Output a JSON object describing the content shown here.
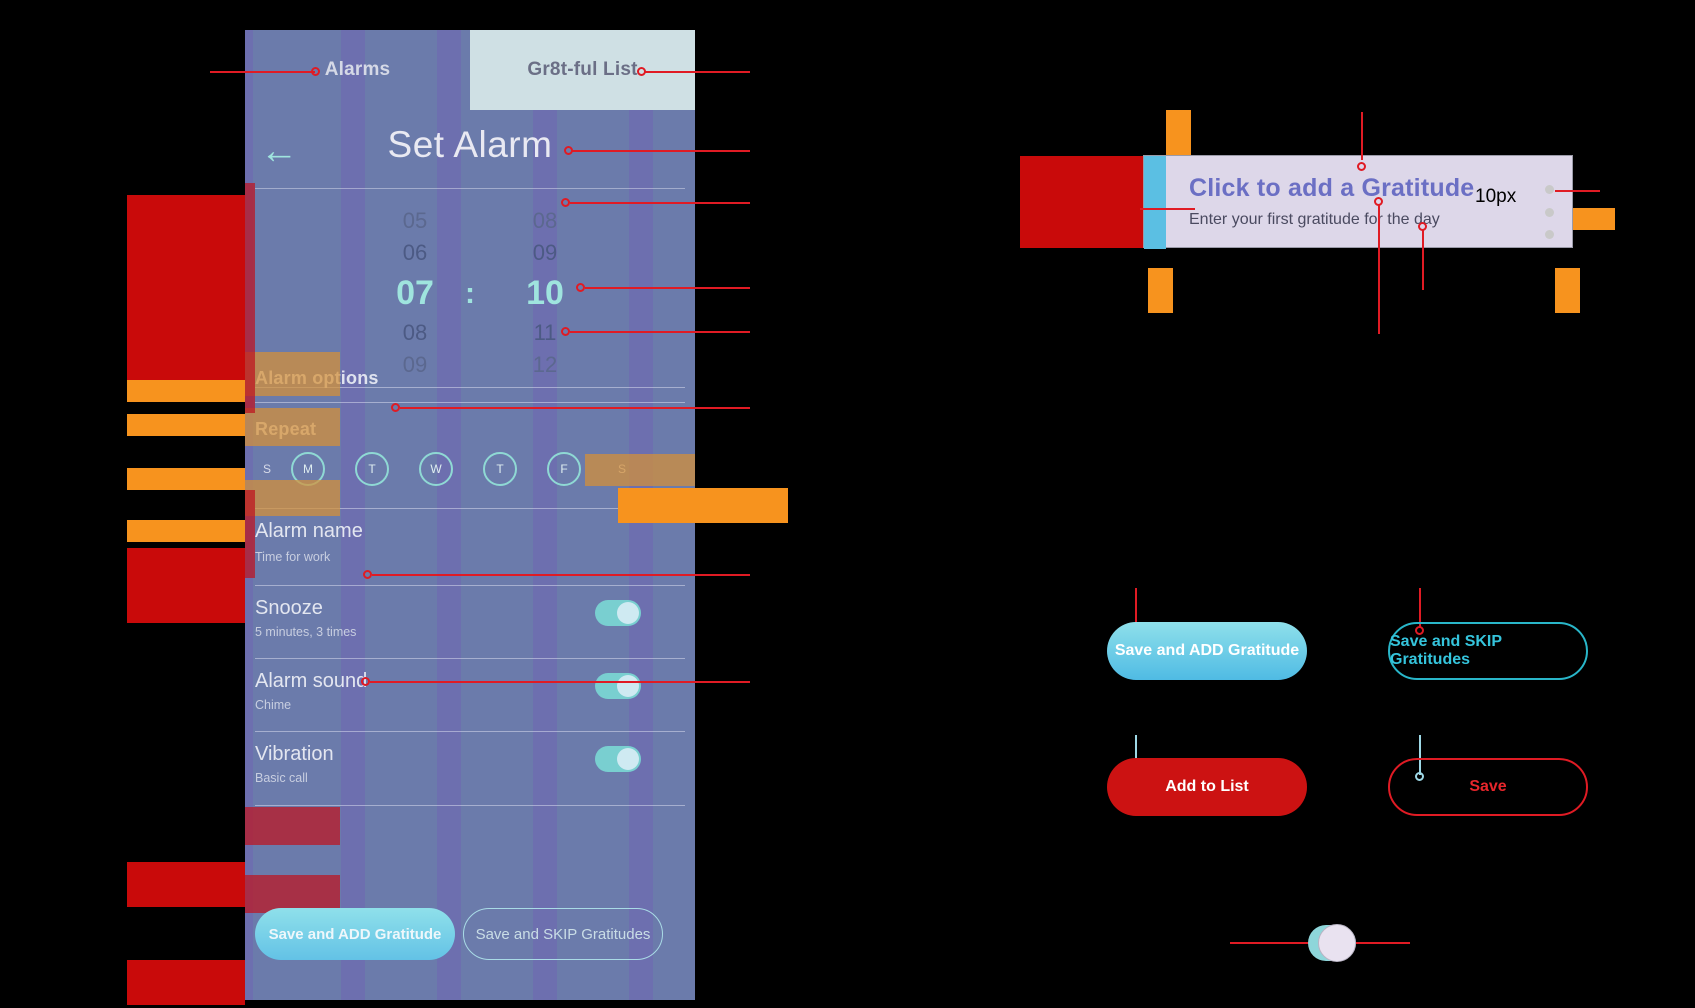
{
  "phone": {
    "tabs": [
      {
        "label": "Alarms",
        "active": false
      },
      {
        "label": "Gr8t-ful List",
        "active": true
      }
    ],
    "header": {
      "back_icon": "arrow-left-icon",
      "title": "Set Alarm"
    },
    "time_picker": {
      "hours": [
        "05",
        "06",
        "07",
        "08",
        "09"
      ],
      "minutes": [
        "08",
        "09",
        "10",
        "11",
        "12"
      ],
      "selected_hour": "07",
      "selected_minute": "10",
      "separator": ":"
    },
    "sections": {
      "alarm_options_label": "Alarm options",
      "repeat_label": "Repeat"
    },
    "repeat_days": [
      {
        "letter": "S",
        "selected": false
      },
      {
        "letter": "M",
        "selected": true
      },
      {
        "letter": "T",
        "selected": true
      },
      {
        "letter": "W",
        "selected": true
      },
      {
        "letter": "T",
        "selected": true
      },
      {
        "letter": "F",
        "selected": true
      },
      {
        "letter": "S",
        "selected": false
      }
    ],
    "rows": [
      {
        "title": "Alarm name",
        "sub": "Time for work",
        "toggle": false
      },
      {
        "title": "Snooze",
        "sub": "5 minutes, 3 times",
        "toggle": true
      },
      {
        "title": "Alarm sound",
        "sub": "Chime",
        "toggle": true
      },
      {
        "title": "Vibration",
        "sub": "Basic call",
        "toggle": true
      }
    ],
    "buttons": {
      "add_gratitude": "Save and ADD Gratitude",
      "skip_gratitudes": "Save and SKIP Gratitudes"
    }
  },
  "gratitude_card": {
    "title": "Click to add a Gratitude",
    "subtitle": "Enter your first gratitude for the day",
    "spacing_label": "10px"
  },
  "right_buttons": {
    "add_gratitude": "Save and ADD Gratitude",
    "skip_gratitudes": "Save and SKIP Gratitudes",
    "add_to_list": "Add to List",
    "save": "Save"
  },
  "colors": {
    "phone_bg": "#6b7bab",
    "accent_cyan": "#9fe4de",
    "annotation_red": "#e01b24",
    "overlay_orange": "#f7931e",
    "card_bg": "#ddd7e9",
    "card_accent": "#5bbfe3",
    "brand_purple": "#6b6fc4",
    "red_button": "#cc1212"
  }
}
